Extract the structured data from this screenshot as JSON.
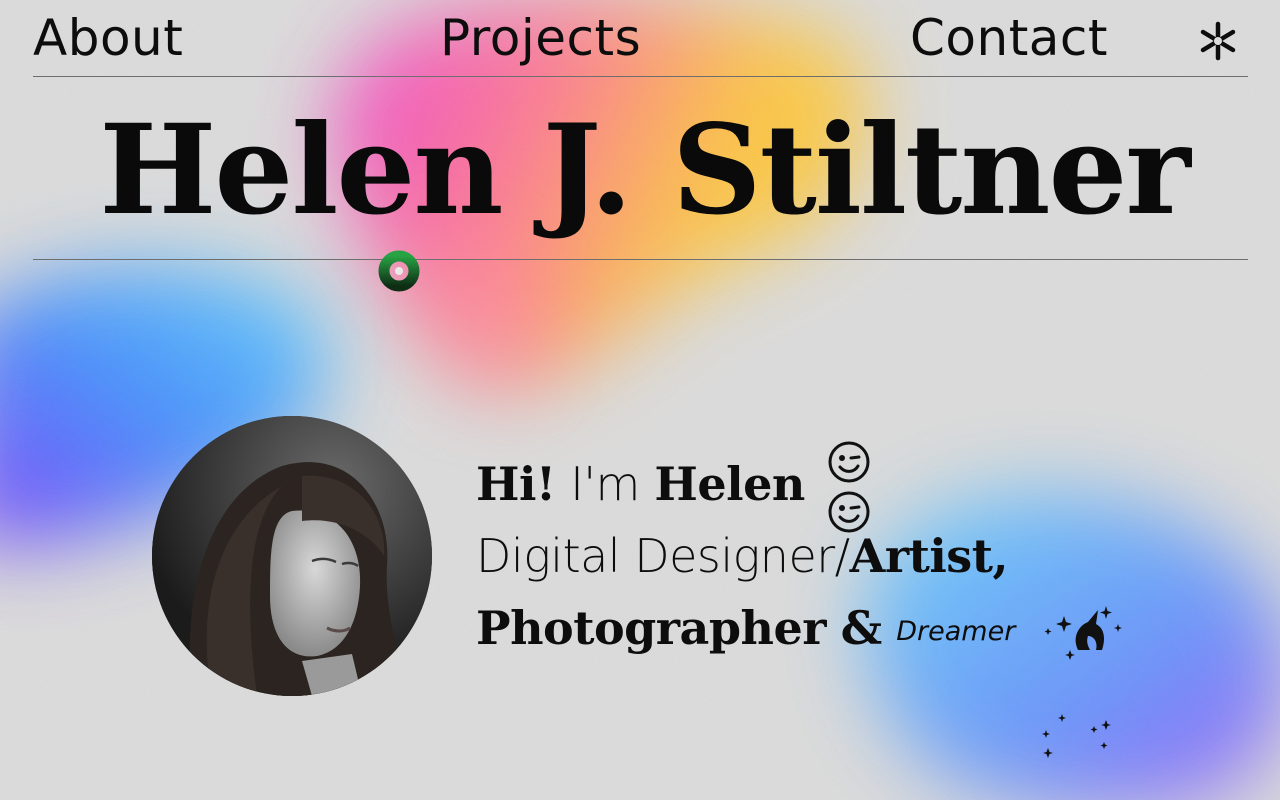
{
  "nav": {
    "about": "About",
    "projects": "Projects",
    "contact": "Contact",
    "menu_icon": "asterisk-icon"
  },
  "hero": {
    "name": "Helen J. Stiltner"
  },
  "intro": {
    "hi": "Hi!",
    "im": "I'm",
    "first_name": "Helen",
    "role_1": "Digital Designer/",
    "role_2": "Artist,",
    "role_3": "Photographer",
    "amp": "&",
    "role_4": "Dreamer",
    "icons": [
      "winking-face-icon",
      "winking-face-icon",
      "unicorn-icon",
      "sparkles-icon"
    ]
  },
  "colors": {
    "background": "#dcdcdc",
    "text": "#0d0d0d",
    "cursor_ring": "#1f8a3a"
  }
}
